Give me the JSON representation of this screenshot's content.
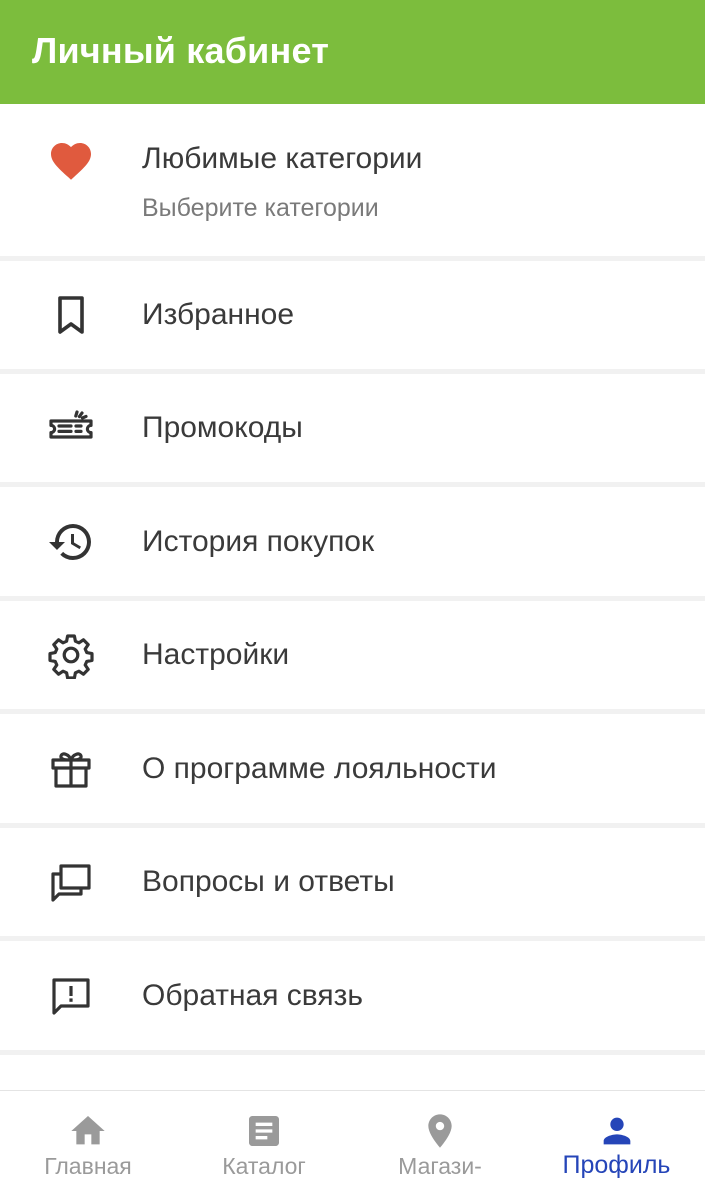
{
  "header": {
    "title": "Личный кабинет"
  },
  "menu": {
    "favorite_categories": {
      "label": "Любимые категории",
      "subtitle": "Выберите категории",
      "icon": "heart-icon"
    },
    "favorites": {
      "label": "Избранное",
      "icon": "bookmark-icon"
    },
    "promocodes": {
      "label": "Промокоды",
      "icon": "ticket-icon"
    },
    "purchase_history": {
      "label": "История покупок",
      "icon": "history-icon"
    },
    "settings": {
      "label": "Настройки",
      "icon": "gear-icon"
    },
    "loyalty": {
      "label": "О программе лояльности",
      "icon": "gift-icon"
    },
    "faq": {
      "label": "Вопросы и ответы",
      "icon": "chat-icon"
    },
    "feedback": {
      "label": "Обратная связь",
      "icon": "feedback-icon"
    }
  },
  "bottom_nav": {
    "items": [
      {
        "label": "Главная",
        "icon": "home-icon"
      },
      {
        "label": "Каталог",
        "icon": "document-icon"
      },
      {
        "label": "Магази-",
        "icon": "location-pin-icon"
      },
      {
        "label": "Профиль",
        "icon": "person-icon"
      }
    ],
    "active_index": 3
  },
  "colors": {
    "header_bg": "#7cbd3d",
    "heart": "#e05a3e",
    "active_nav": "#2545b8",
    "inactive_nav": "#9a9a9a"
  }
}
